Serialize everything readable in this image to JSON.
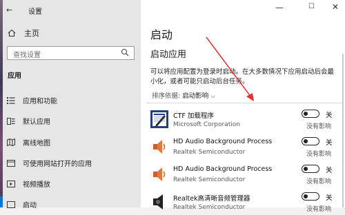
{
  "window": {
    "back_label": "←",
    "title": "设置",
    "minimize_label": "—",
    "maximize_label": "☐",
    "close_label": "✕"
  },
  "sidebar": {
    "home_label": "主页",
    "search_placeholder": "查找设置",
    "section_title": "应用",
    "items": [
      {
        "label": "应用和功能",
        "icon": "list-icon"
      },
      {
        "label": "默认应用",
        "icon": "default-apps-icon"
      },
      {
        "label": "离线地图",
        "icon": "map-icon"
      },
      {
        "label": "可使用网站打开的应用",
        "icon": "website-apps-icon"
      },
      {
        "label": "视频播放",
        "icon": "video-icon"
      },
      {
        "label": "启动",
        "icon": "startup-icon"
      }
    ]
  },
  "main": {
    "title": "启动",
    "subtitle": "启动应用",
    "description": "可以将应用配置为登录时启动。在大多数情况下应用启动后会最小化，或者可能只启动后台任务。",
    "sort_label": "排序依据:",
    "sort_value": "启动影响",
    "apps": [
      {
        "name": "CTF 加载程序",
        "publisher": "Microsoft Corporation",
        "state": "关",
        "impact": "没有影响",
        "icon": "ctf-loader-icon"
      },
      {
        "name": "HD Audio Background Process",
        "publisher": "Realtek Semiconductor",
        "state": "关",
        "impact": "没有影响",
        "icon": "speaker-icon"
      },
      {
        "name": "HD Audio Background Process",
        "publisher": "Realtek Semiconductor",
        "state": "关",
        "impact": "没有影响",
        "icon": "speaker-icon"
      },
      {
        "name": "Realtek高清晰音频管理器",
        "publisher": "Realtek Semiconductor",
        "state": "关",
        "impact": "没有影响",
        "icon": "realtek-speaker-icon"
      }
    ]
  },
  "colors": {
    "accent": "#0078d7",
    "arrow": "#e03030"
  }
}
